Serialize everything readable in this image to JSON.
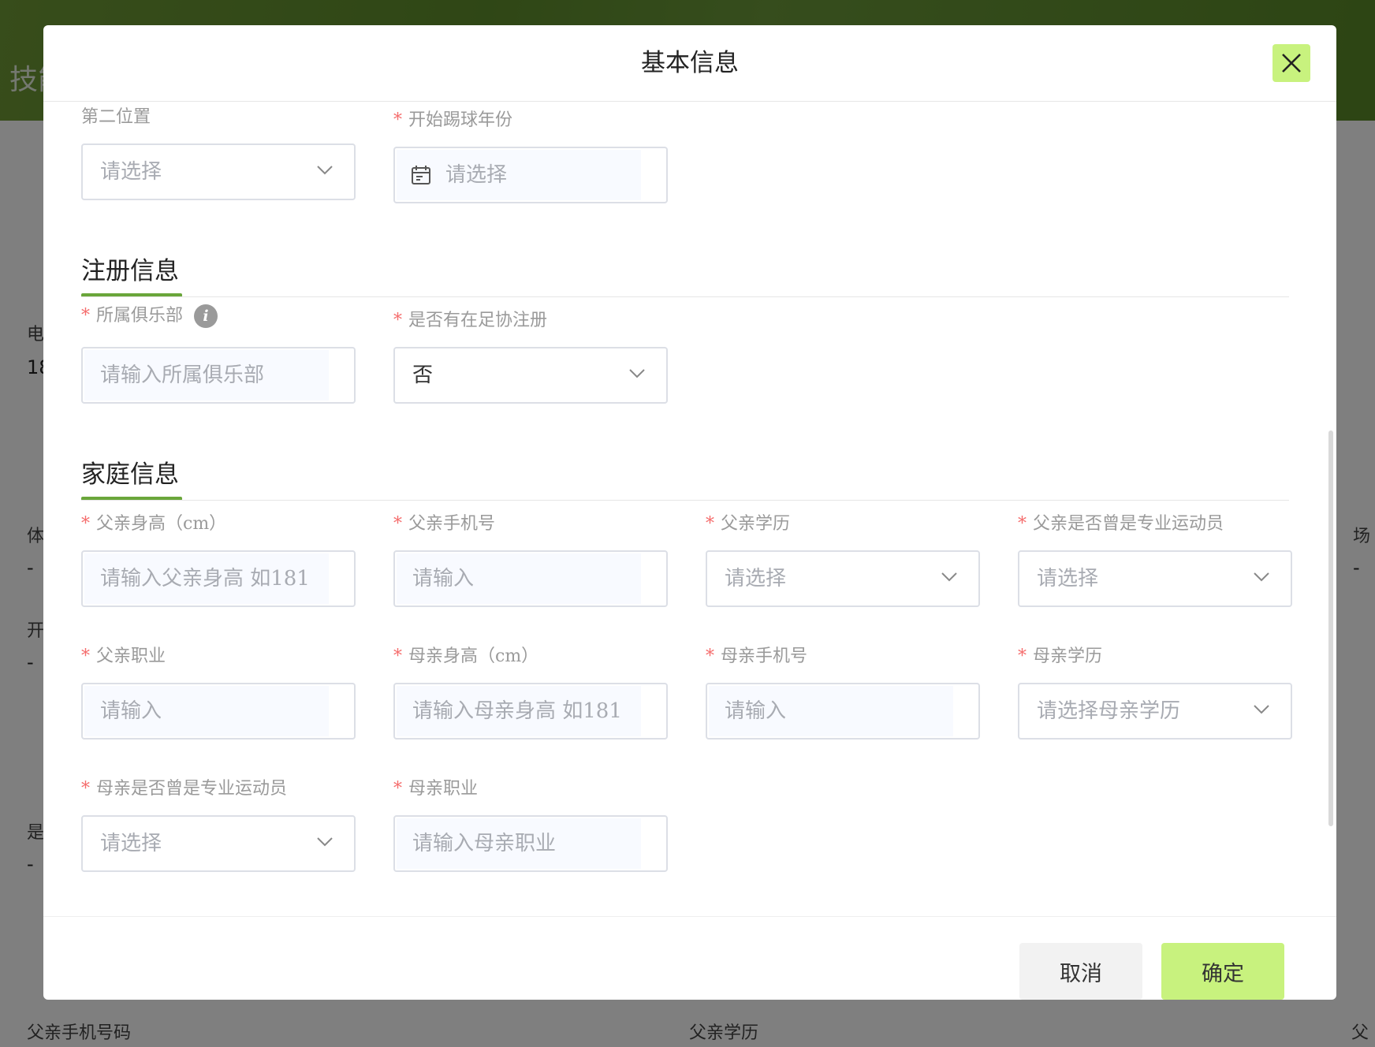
{
  "background": {
    "header_title": "技能",
    "labels": {
      "phone": "电",
      "phone_value": "18",
      "body": "体",
      "body_value": "-",
      "start": "开",
      "start_value": "-",
      "is": "是",
      "is_value": "-",
      "field_right": "场",
      "field_right_value": "-",
      "father_phone": "父亲手机号码",
      "father_edu": "父亲学历",
      "father_right": "父"
    }
  },
  "modal": {
    "title": "基本信息",
    "top_fields": {
      "second_position": {
        "label": "第二位置",
        "placeholder": "请选择"
      },
      "start_year": {
        "label": "开始踢球年份",
        "placeholder": "请选择"
      }
    },
    "registration": {
      "title": "注册信息",
      "club": {
        "label": "所属俱乐部",
        "placeholder": "请输入所属俱乐部"
      },
      "fa_registered": {
        "label": "是否有在足协注册",
        "value": "否"
      }
    },
    "family": {
      "title": "家庭信息",
      "father_height": {
        "label": "父亲身高（cm）",
        "placeholder": "请输入父亲身高 如181"
      },
      "father_phone": {
        "label": "父亲手机号",
        "placeholder": "请输入"
      },
      "father_education": {
        "label": "父亲学历",
        "placeholder": "请选择"
      },
      "father_pro": {
        "label": "父亲是否曾是专业运动员",
        "placeholder": "请选择"
      },
      "father_job": {
        "label": "父亲职业",
        "placeholder": "请输入"
      },
      "mother_height": {
        "label": "母亲身高（cm）",
        "placeholder": "请输入母亲身高 如181"
      },
      "mother_phone": {
        "label": "母亲手机号",
        "placeholder": "请输入"
      },
      "mother_education": {
        "label": "母亲学历",
        "placeholder": "请选择母亲学历"
      },
      "mother_pro": {
        "label": "母亲是否曾是专业运动员",
        "placeholder": "请选择"
      },
      "mother_job": {
        "label": "母亲职业",
        "placeholder": "请输入母亲职业"
      }
    },
    "footer": {
      "cancel": "取消",
      "confirm": "确定"
    },
    "required_mark": "*"
  },
  "colors": {
    "accent": "#c8f27e",
    "section_bar": "#6aa63a",
    "required": "#f56c6c",
    "header_bg": "#5f8e2c"
  },
  "icons": {
    "close": "close-icon",
    "chevron": "chevron-down-icon",
    "calendar": "calendar-icon",
    "info": "info-icon"
  }
}
